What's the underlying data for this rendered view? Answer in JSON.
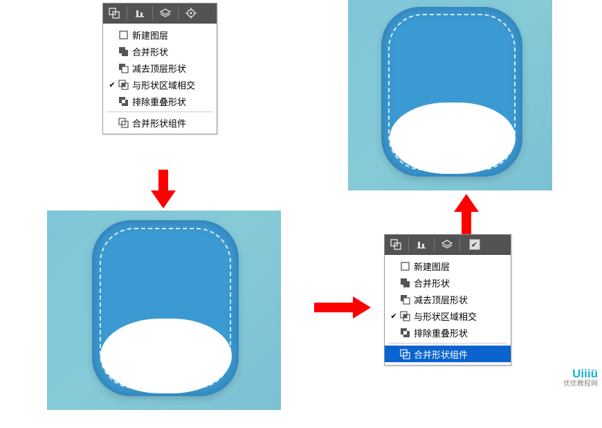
{
  "menu1": {
    "items": [
      {
        "label": "新建图层",
        "icon": "square"
      },
      {
        "label": "合并形状",
        "icon": "combine"
      },
      {
        "label": "减去顶层形状",
        "icon": "subtract"
      },
      {
        "label": "与形状区域相交",
        "icon": "intersect",
        "checked": true
      },
      {
        "label": "排除重叠形状",
        "icon": "exclude"
      }
    ],
    "merge_label": "合并形状组件"
  },
  "menu2": {
    "items": [
      {
        "label": "新建图层",
        "icon": "square"
      },
      {
        "label": "合并形状",
        "icon": "combine"
      },
      {
        "label": "减去顶层形状",
        "icon": "subtract"
      },
      {
        "label": "与形状区域相交",
        "icon": "intersect",
        "checked": true
      },
      {
        "label": "排除重叠形状",
        "icon": "exclude"
      }
    ],
    "merge_label": "合并形状组件",
    "merge_selected": true
  },
  "watermark": {
    "main": "Uiiiü",
    "sub": "优优教程网"
  }
}
